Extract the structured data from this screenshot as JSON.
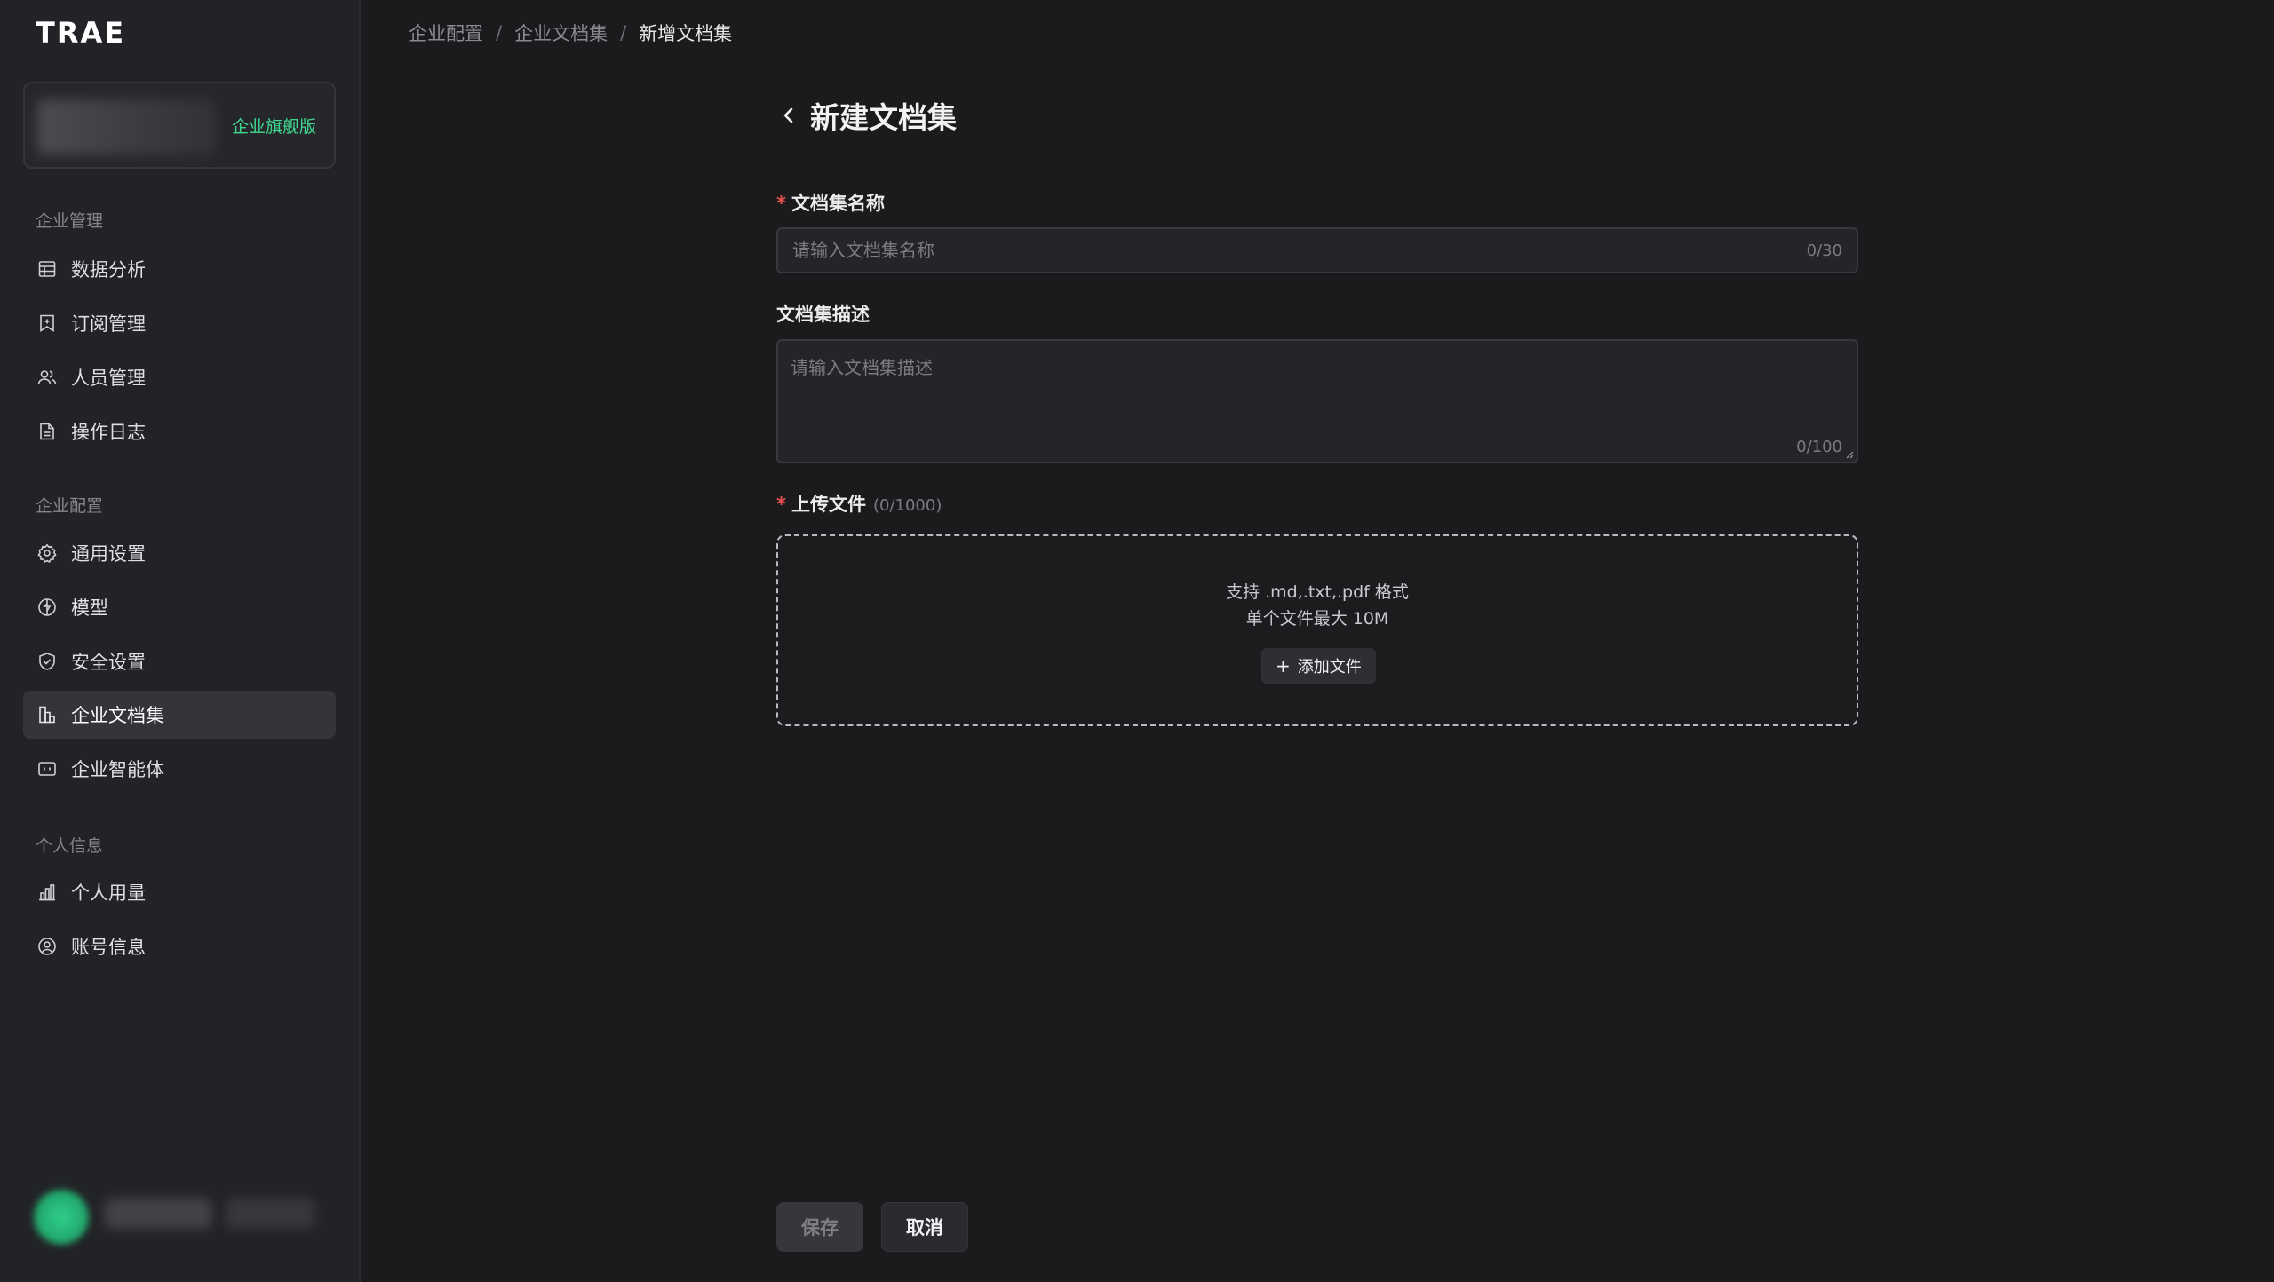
{
  "app": {
    "logo_text": "TRAE"
  },
  "org": {
    "badge": "企业旗舰版"
  },
  "sidebar": {
    "sections": [
      {
        "title": "企业管理"
      },
      {
        "title": "企业配置"
      },
      {
        "title": "个人信息"
      }
    ],
    "items": [
      {
        "label": "数据分析",
        "icon": "table-icon"
      },
      {
        "label": "订阅管理",
        "icon": "bookmark-icon"
      },
      {
        "label": "人员管理",
        "icon": "users-icon"
      },
      {
        "label": "操作日志",
        "icon": "file-text-icon"
      },
      {
        "label": "通用设置",
        "icon": "gear-icon"
      },
      {
        "label": "模型",
        "icon": "model-icon"
      },
      {
        "label": "安全设置",
        "icon": "shield-icon"
      },
      {
        "label": "企业文档集",
        "icon": "docs-icon",
        "active": true
      },
      {
        "label": "企业智能体",
        "icon": "agent-icon"
      },
      {
        "label": "个人用量",
        "icon": "bar-chart-icon"
      },
      {
        "label": "账号信息",
        "icon": "user-circle-icon"
      }
    ]
  },
  "breadcrumb": {
    "items": [
      "企业配置",
      "企业文档集",
      "新增文档集"
    ],
    "separator": "/"
  },
  "page": {
    "title": "新建文档集"
  },
  "form": {
    "name": {
      "label": "文档集名称",
      "placeholder": "请输入文档集名称",
      "counter": "0/30",
      "required": true
    },
    "description": {
      "label": "文档集描述",
      "placeholder": "请输入文档集描述",
      "counter": "0/100"
    },
    "upload": {
      "label": "上传文件",
      "hint": "(0/1000)",
      "required": true,
      "formats": "支持 .md,.txt,.pdf 格式",
      "max_size": "单个文件最大 10M",
      "add_button": "添加文件"
    }
  },
  "actions": {
    "save": "保存",
    "cancel": "取消"
  },
  "colors": {
    "accent_green": "#3fd88f",
    "required_red": "#f0534f",
    "background": "#1b1b1d",
    "sidebar": "#222326"
  }
}
